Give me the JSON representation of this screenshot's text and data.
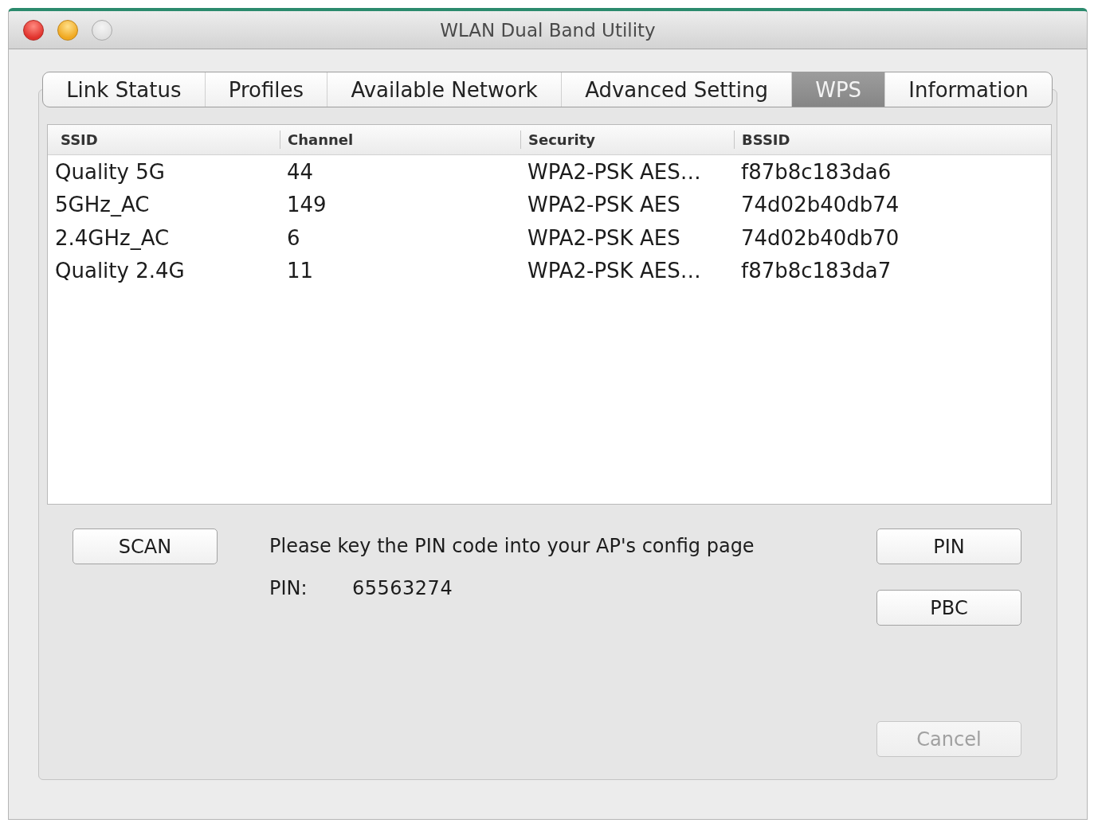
{
  "window": {
    "title": "WLAN Dual Band Utility",
    "controls": [
      {
        "kind": "close",
        "disabled": false
      },
      {
        "kind": "minimize",
        "disabled": false
      },
      {
        "kind": "zoom",
        "disabled": true
      }
    ]
  },
  "tabs": [
    {
      "label": "Link Status",
      "selected": false
    },
    {
      "label": "Profiles",
      "selected": false
    },
    {
      "label": "Available Network",
      "selected": false
    },
    {
      "label": "Advanced Setting",
      "selected": false
    },
    {
      "label": "WPS",
      "selected": true
    },
    {
      "label": "Information",
      "selected": false
    }
  ],
  "network_table": {
    "columns": [
      "SSID",
      "Channel",
      "Security",
      "BSSID"
    ],
    "rows": [
      [
        "Quality 5G",
        "44",
        "WPA2-PSK AES…",
        "f87b8c183da6"
      ],
      [
        "5GHz_AC",
        "149",
        "WPA2-PSK AES",
        "74d02b40db74"
      ],
      [
        "2.4GHz_AC",
        "6",
        "WPA2-PSK AES",
        "74d02b40db70"
      ],
      [
        "Quality 2.4G",
        "11",
        "WPA2-PSK AES…",
        "f87b8c183da7"
      ]
    ]
  },
  "wps": {
    "scan_button": {
      "label": "SCAN",
      "disabled": false
    },
    "message": "Please key the PIN code into your AP's config page",
    "pin_label": "PIN:",
    "pin_value": "65563274",
    "buttons": [
      {
        "label": "PIN",
        "disabled": false
      },
      {
        "label": "PBC",
        "disabled": false
      }
    ],
    "cancel_button": {
      "label": "Cancel",
      "disabled": true
    }
  }
}
